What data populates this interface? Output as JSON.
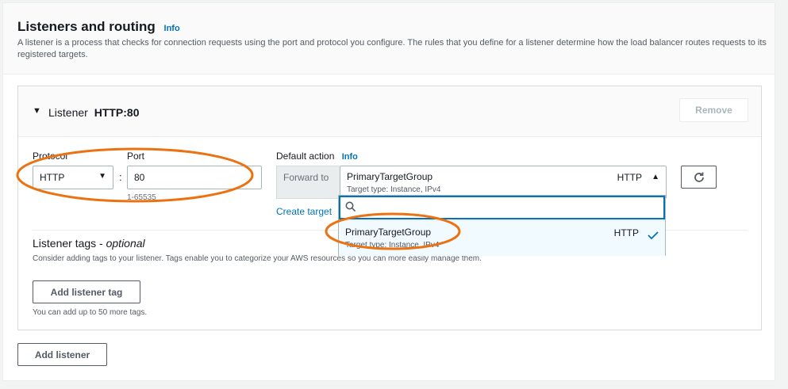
{
  "section": {
    "title": "Listeners and routing",
    "info": "Info",
    "description": "A listener is a process that checks for connection requests using the port and protocol you configure. The rules that you define for a listener determine how the load balancer routes requests to its registered targets."
  },
  "listener": {
    "prefix": "Listener",
    "name": "HTTP:80",
    "remove_label": "Remove",
    "protocol_label": "Protocol",
    "protocol_value": "HTTP",
    "port_label": "Port",
    "port_value": "80",
    "port_hint": "1-65535",
    "colon": ":",
    "default_action_label": "Default action",
    "default_action_info": "Info",
    "forward_to_label": "Forward to",
    "target_group": {
      "name": "PrimaryTargetGroup",
      "protocol": "HTTP",
      "subtitle": "Target type: Instance, IPv4"
    },
    "create_target_link": "Create target",
    "tags_title": "Listener tags - ",
    "tags_optional": "optional",
    "tags_description": "Consider adding tags to your listener. Tags enable you to categorize your AWS resources so you can more easily manage them.",
    "add_tag_label": "Add listener tag",
    "tags_hint": "You can add up to 50 more tags."
  },
  "dropdown": {
    "search_value": "",
    "options": [
      {
        "name": "PrimaryTargetGroup",
        "protocol": "HTTP",
        "subtitle": "Target type: Instance, IPv4",
        "selected": true
      }
    ]
  },
  "add_listener_label": "Add listener",
  "colors": {
    "link": "#0073bb",
    "annotation": "#ec7211",
    "text": "#16191f",
    "selected_bg": "#f1faff"
  }
}
